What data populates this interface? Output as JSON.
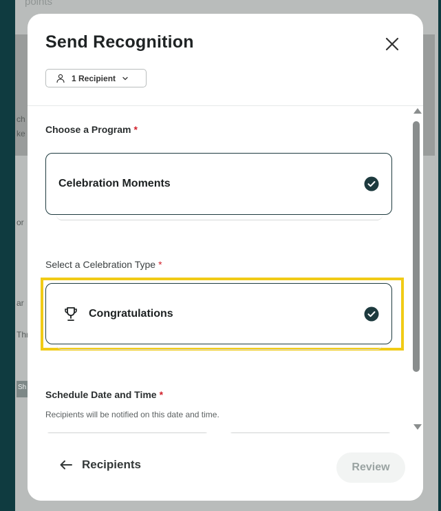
{
  "background": {
    "top_text": "points",
    "fragments": [
      "ch",
      "ke",
      "or",
      "ar",
      "Thr",
      "Sh"
    ]
  },
  "modal": {
    "title": "Send Recognition",
    "recipient_chip": "1 Recipient",
    "choose_program": {
      "label": "Choose a Program",
      "required_mark": "*",
      "selected": "Celebration Moments"
    },
    "celebration_type": {
      "label": "Select a Celebration Type",
      "required_mark": "*",
      "selected": "Congratulations"
    },
    "schedule": {
      "label": "Schedule Date and Time",
      "required_mark": "*",
      "helper": "Recipients will be notified on this date and time."
    },
    "footer": {
      "back_label": "Recipients",
      "review_label": "Review"
    }
  },
  "colors": {
    "accent_dark": "#1d3a3e",
    "highlight": "#f1cb16",
    "required": "#d11f2a"
  },
  "icons": {
    "close": "close-icon",
    "person": "person-icon",
    "chevron": "chevron-down-icon",
    "check": "check-circle-icon",
    "trophy": "trophy-icon",
    "arrow": "arrow-left-icon"
  }
}
